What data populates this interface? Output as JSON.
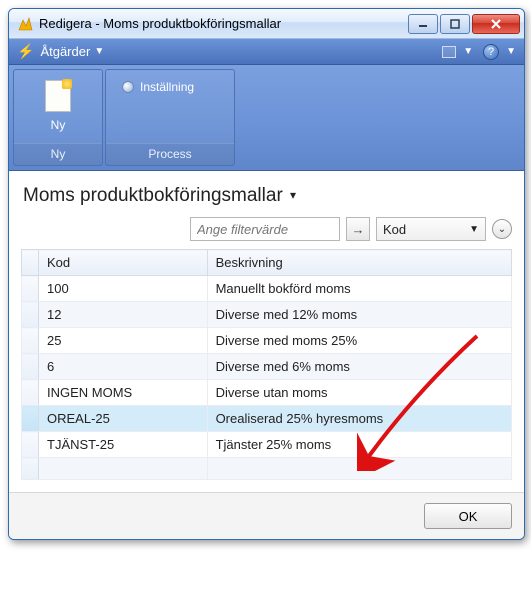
{
  "window": {
    "title": "Redigera - Moms produktbokföringsmallar"
  },
  "actionsbar": {
    "label": "Åtgärder"
  },
  "ribbon": {
    "ny_button": "Ny",
    "ny_group": "Ny",
    "settings_button": "Inställning",
    "process_group": "Process"
  },
  "page": {
    "title": "Moms produktbokföringsmallar"
  },
  "filter": {
    "placeholder": "Ange filtervärde",
    "field": "Kod"
  },
  "table": {
    "headers": {
      "kod": "Kod",
      "beskrivning": "Beskrivning"
    },
    "rows": [
      {
        "kod": "100",
        "besk": "Manuellt bokförd moms"
      },
      {
        "kod": "12",
        "besk": "Diverse med 12% moms"
      },
      {
        "kod": "25",
        "besk": "Diverse med moms 25%"
      },
      {
        "kod": "6",
        "besk": "Diverse med 6% moms"
      },
      {
        "kod": "INGEN MOMS",
        "besk": "Diverse utan moms"
      },
      {
        "kod": "OREAL-25",
        "besk": "Orealiserad 25% hyresmoms"
      },
      {
        "kod": "TJÄNST-25",
        "besk": "Tjänster 25% moms"
      }
    ]
  },
  "footer": {
    "ok": "OK"
  }
}
